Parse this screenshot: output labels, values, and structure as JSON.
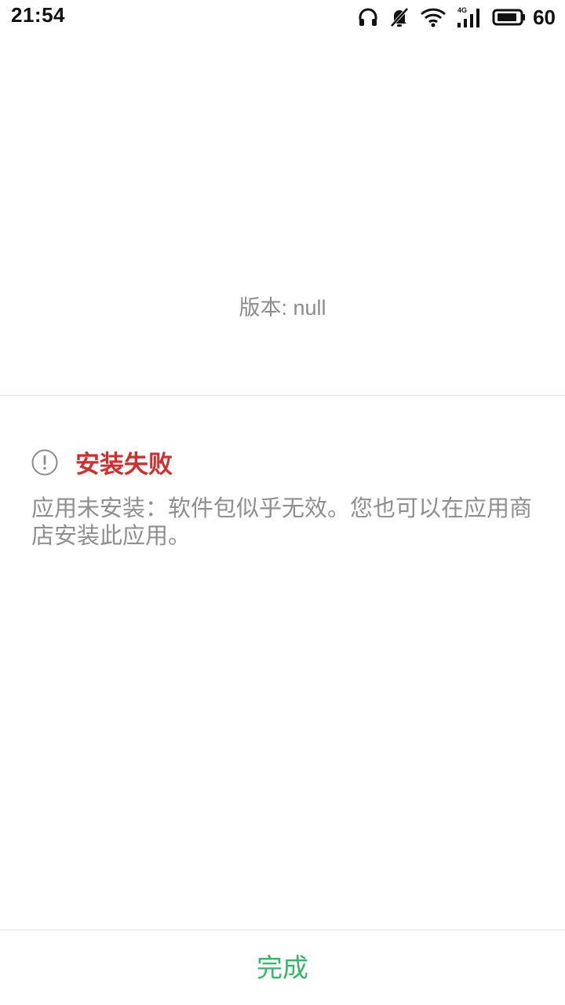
{
  "status_bar": {
    "time": "21:54",
    "battery_level": "60",
    "network_label": "4G",
    "icons": [
      "headphones-icon",
      "bell-muted-icon",
      "wifi-icon",
      "cellular-signal-icon",
      "battery-icon"
    ]
  },
  "app_info": {
    "version_text": "版本: null"
  },
  "error": {
    "title": "安装失败",
    "message": "应用未安装：软件包似乎无效。您也可以在应用商店安装此应用。",
    "icon": "alert-circle-icon",
    "title_color": "#d12e2e"
  },
  "footer": {
    "done_label": "完成",
    "done_color": "#34b767"
  }
}
